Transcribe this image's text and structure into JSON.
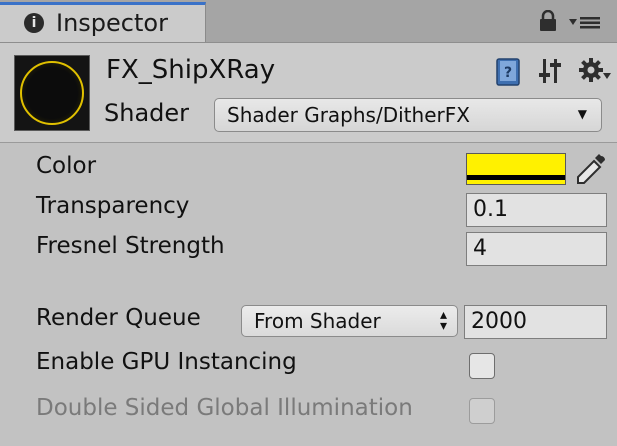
{
  "tab": {
    "title": "Inspector",
    "icon": "info-icon",
    "icon_glyph": "i"
  },
  "header": {
    "material_name": "FX_ShipXRay",
    "shader_label": "Shader",
    "shader_value": "Shader Graphs/DitherFX",
    "preview_color": "#e0c000"
  },
  "properties": {
    "color": {
      "label": "Color",
      "value_hex": "#fff100"
    },
    "transparency": {
      "label": "Transparency",
      "value": "0.1"
    },
    "fresnel": {
      "label": "Fresnel Strength",
      "value": "4"
    },
    "render_queue": {
      "label": "Render Queue",
      "mode": "From Shader",
      "value": "2000"
    },
    "gpu_instancing": {
      "label": "Enable GPU Instancing",
      "checked": false
    },
    "double_sided_gi": {
      "label": "Double Sided Global Illumination",
      "checked": false,
      "disabled": true
    }
  },
  "colors": {
    "accent": "#3a72c8",
    "panel": "#c2c2c2",
    "header": "#cbcbcb"
  }
}
